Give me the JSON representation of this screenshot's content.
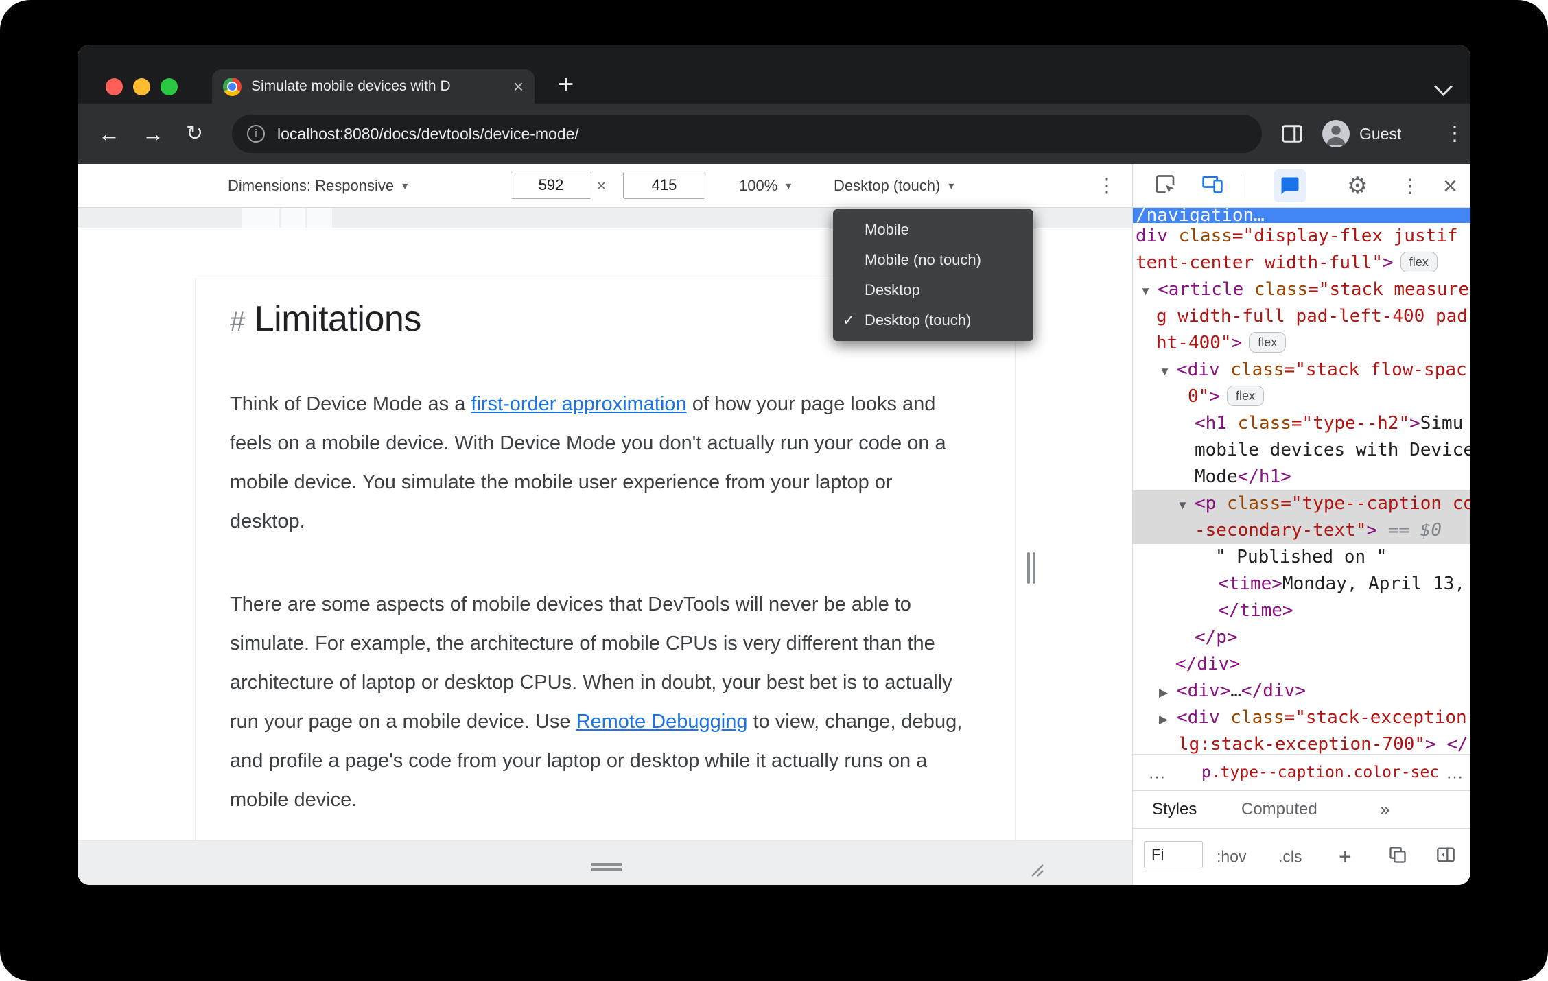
{
  "colors": {
    "accent_blue": "#1a73e8",
    "selection_gray": "#dadada"
  },
  "browser": {
    "tab_title": "Simulate mobile devices with D",
    "url": "localhost:8080/docs/devtools/device-mode/",
    "guest_label": "Guest"
  },
  "device_toolbar": {
    "dimensions_label": "Dimensions: Responsive",
    "width_value": "592",
    "multiply_sign": "×",
    "height_value": "415",
    "zoom_value": "100%",
    "device_type_value": "Desktop (touch)"
  },
  "device_type_menu": {
    "check_glyph": "✓",
    "items": [
      {
        "label": "Mobile",
        "checked": false
      },
      {
        "label": "Mobile (no touch)",
        "checked": false
      },
      {
        "label": "Desktop",
        "checked": false
      },
      {
        "label": "Desktop (touch)",
        "checked": true
      }
    ]
  },
  "page": {
    "heading_hash": "#",
    "heading": "Limitations",
    "paragraphs": [
      {
        "parts": [
          {
            "text": "Think of Device Mode as a ",
            "link": false
          },
          {
            "text": "first-order approximation",
            "link": true
          },
          {
            "text": " of how your page looks and feels on a mobile device. With Device Mode you don't actually run your code on a mobile device. You simulate the mobile user experience from your laptop or desktop.",
            "link": false
          }
        ]
      },
      {
        "parts": [
          {
            "text": "There are some aspects of mobile devices that DevTools will never be able to simulate. For example, the architecture of mobile CPUs is very different than the architecture of laptop or desktop CPUs. When in doubt, your best bet is to actually run your page on a mobile device. Use ",
            "link": false
          },
          {
            "text": "Remote Debugging",
            "link": true
          },
          {
            "text": " to view, change, debug, and profile a page's code from your laptop or desktop while it actually runs on a mobile device.",
            "link": false
          }
        ]
      }
    ]
  },
  "devtools": {
    "dom_lines": [
      {
        "blue": true,
        "pl": 4,
        "tokens": [
          [
            "wht",
            "/navigation…"
          ]
        ]
      },
      {
        "pl": 4,
        "tokens": [
          [
            "tag",
            "div"
          ],
          [
            "pln",
            " "
          ],
          [
            "attr",
            "class"
          ],
          [
            "val",
            "=\"display-flex justif"
          ]
        ]
      },
      {
        "pl": 4,
        "tokens": [
          [
            "val",
            "tent-center width-full\""
          ],
          [
            "tag",
            ">"
          ]
        ],
        "badge": "flex"
      },
      {
        "pl": 10,
        "arrow": "▼",
        "tokens": [
          [
            "tag",
            "<article"
          ],
          [
            "pln",
            " "
          ],
          [
            "attr",
            "class"
          ],
          [
            "val",
            "=\"stack measure"
          ]
        ]
      },
      {
        "pl": 34,
        "tokens": [
          [
            "val",
            "g width-full pad-left-400 pad"
          ]
        ]
      },
      {
        "pl": 34,
        "tokens": [
          [
            "val",
            "ht-400\""
          ],
          [
            "tag",
            ">"
          ]
        ],
        "badge": "flex"
      },
      {
        "pl": 38,
        "arrow": "▼",
        "tokens": [
          [
            "tag",
            "<div"
          ],
          [
            "pln",
            " "
          ],
          [
            "attr",
            "class"
          ],
          [
            "val",
            "=\"stack flow-spac"
          ]
        ]
      },
      {
        "pl": 80,
        "tokens": [
          [
            "val",
            "0\""
          ],
          [
            "tag",
            ">"
          ]
        ],
        "badge": "flex"
      },
      {
        "pl": 90,
        "tokens": [
          [
            "tag",
            "<h1"
          ],
          [
            "pln",
            " "
          ],
          [
            "attr",
            "class"
          ],
          [
            "val",
            "=\"type--h2\""
          ],
          [
            "tag",
            ">"
          ],
          [
            "pln",
            "Simu"
          ]
        ]
      },
      {
        "pl": 90,
        "tokens": [
          [
            "pln",
            "mobile devices with Device"
          ]
        ]
      },
      {
        "pl": 90,
        "tokens": [
          [
            "pln",
            "Mode"
          ],
          [
            "tag",
            "</h1>"
          ]
        ]
      },
      {
        "pl": 64,
        "arrow": "▼",
        "sel": true,
        "tokens": [
          [
            "tag",
            "<p"
          ],
          [
            "pln",
            " "
          ],
          [
            "attr",
            "class"
          ],
          [
            "val",
            "=\"type--caption co"
          ]
        ]
      },
      {
        "pl": 90,
        "sel": true,
        "tokens": [
          [
            "val",
            "-secondary-text\""
          ],
          [
            "tag",
            ">"
          ],
          [
            "eq",
            " == $0"
          ]
        ]
      },
      {
        "pl": 120,
        "tokens": [
          [
            "pln",
            "\" Published on \""
          ]
        ]
      },
      {
        "pl": 124,
        "tokens": [
          [
            "tag",
            "<time>"
          ],
          [
            "pln",
            "Monday, April 13,"
          ]
        ]
      },
      {
        "pl": 124,
        "tokens": [
          [
            "tag",
            "</time>"
          ]
        ]
      },
      {
        "pl": 90,
        "tokens": [
          [
            "tag",
            "</p>"
          ]
        ]
      },
      {
        "pl": 62,
        "tokens": [
          [
            "tag",
            "</div>"
          ]
        ]
      },
      {
        "pl": 38,
        "arrow": "▶",
        "tokens": [
          [
            "tag",
            "<div>"
          ],
          [
            "pln",
            "…"
          ],
          [
            "tag",
            "</div>"
          ]
        ]
      },
      {
        "pl": 38,
        "arrow": "▶",
        "tokens": [
          [
            "tag",
            "<div"
          ],
          [
            "pln",
            " "
          ],
          [
            "attr",
            "class"
          ],
          [
            "val",
            "=\"stack-exception-"
          ]
        ]
      },
      {
        "pl": 66,
        "tokens": [
          [
            "val",
            "lg:stack-exception-700\""
          ],
          [
            "tag",
            "> </"
          ]
        ]
      }
    ],
    "breadcrumbs": {
      "left_more": "…",
      "selected_tag": "p",
      "selected_classes": ".type--caption.color-sec",
      "right_more": "…"
    },
    "sidebar_tabs": {
      "styles": "Styles",
      "computed": "Computed",
      "more_glyph": "»"
    },
    "filter_bar": {
      "filter_value": "Fi",
      "hov": ":hov",
      "cls": ".cls",
      "plus": "+"
    }
  }
}
